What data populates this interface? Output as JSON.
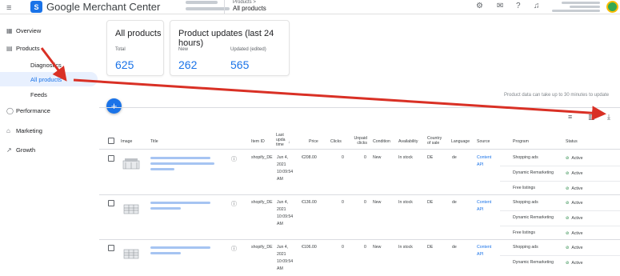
{
  "topbar": {
    "menu_icon": "≡",
    "app_title": "Google Merchant Center",
    "breadcrumb_parent": "Products >",
    "breadcrumb_current": "All products"
  },
  "sidebar": {
    "items": [
      {
        "label": "Overview",
        "icon": "overview-icon"
      },
      {
        "label": "Products",
        "icon": "products-icon"
      },
      {
        "label": "Diagnostics"
      },
      {
        "label": "All products"
      },
      {
        "label": "Feeds"
      },
      {
        "label": "Performance",
        "icon": "performance-icon"
      },
      {
        "label": "Marketing",
        "icon": "marketing-icon"
      },
      {
        "label": "Growth",
        "icon": "growth-icon"
      }
    ]
  },
  "cards": {
    "all_products": {
      "title": "All products",
      "total_label": "Total",
      "total_value": "625"
    },
    "updates": {
      "title": "Product updates (last 24 hours)",
      "new_label": "New",
      "new_value": "262",
      "updated_label": "Updated (edited)",
      "updated_value": "565"
    }
  },
  "note": "Product data can take up to 30 minutes to update",
  "table": {
    "headers": {
      "image": "Image",
      "title": "Title",
      "item_id": "Item ID",
      "last_update": "Last upda time",
      "price": "Price",
      "clicks": "Clicks",
      "unpaid_clicks": "Unpaid clicks",
      "condition": "Condition",
      "availability": "Availability",
      "country": "Country of sale",
      "language": "Language",
      "source": "Source",
      "program": "Program",
      "status": "Status"
    },
    "rows": [
      {
        "item_id": "shopify_DE",
        "date1": "Jun 4,",
        "date2": "2021",
        "date3": "10:09:54",
        "date4": "AM",
        "price": "€208.00",
        "clicks": "0",
        "unpaid": "0",
        "condition": "New",
        "availability": "In stock",
        "country": "DE",
        "language": "de",
        "source1": "Content",
        "source2": "API",
        "programs": [
          "Shopping ads",
          "Dynamic Remarketing",
          "Free listings"
        ],
        "statuses": [
          "Active",
          "Active",
          "Active"
        ]
      },
      {
        "item_id": "shopify_DE",
        "date1": "Jun 4,",
        "date2": "2021",
        "date3": "10:09:54",
        "date4": "AM",
        "price": "€136.00",
        "clicks": "0",
        "unpaid": "0",
        "condition": "New",
        "availability": "In stock",
        "country": "DE",
        "language": "de",
        "source1": "Content",
        "source2": "API",
        "programs": [
          "Shopping ads",
          "Dynamic Remarketing",
          "Free listings"
        ],
        "statuses": [
          "Active",
          "Active",
          "Active"
        ]
      },
      {
        "item_id": "shopify_DE",
        "date1": "Jun 4,",
        "date2": "2021",
        "date3": "10:09:54",
        "date4": "AM",
        "price": "€106.00",
        "clicks": "0",
        "unpaid": "0",
        "condition": "New",
        "availability": "In stock",
        "country": "DE",
        "language": "de",
        "source1": "Content",
        "source2": "API",
        "programs": [
          "Shopping ads",
          "Dynamic Remarketing"
        ],
        "statuses": [
          "Active",
          "Active"
        ]
      }
    ]
  },
  "colors": {
    "accent": "#1a73e8",
    "arrow": "#d93025",
    "active": "#188038"
  }
}
